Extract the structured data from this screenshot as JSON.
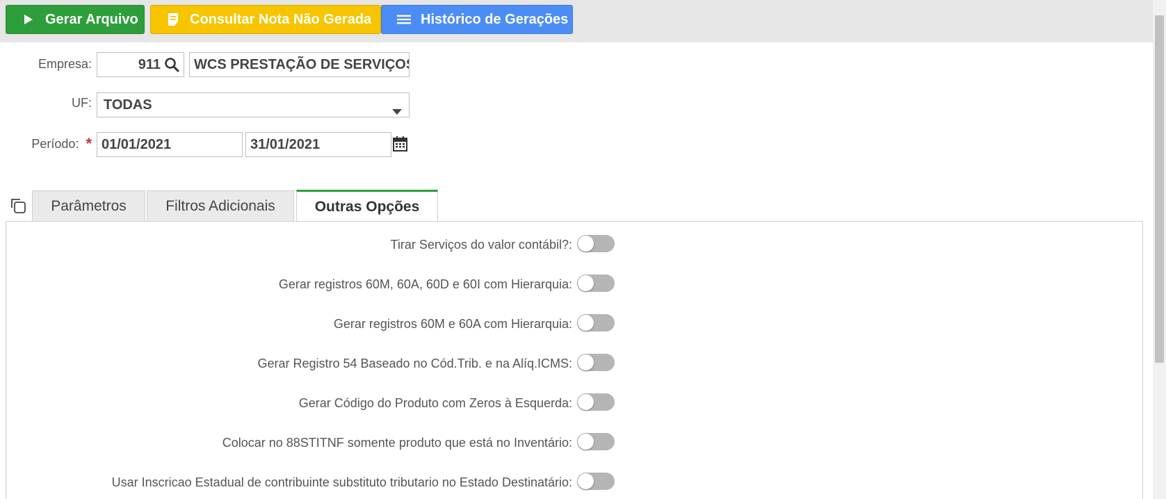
{
  "toolbar": {
    "gerar_label": "Gerar Arquivo",
    "consultar_label": "Consultar Nota Não Gerada",
    "historico_label": "Histórico de Gerações"
  },
  "form": {
    "empresa_label": "Empresa:",
    "empresa_code": "911",
    "empresa_name": "WCS PRESTAÇÃO DE SERVIÇOS",
    "uf_label": "UF:",
    "uf_value": "TODAS",
    "periodo_label": "Período:",
    "periodo_required": "*",
    "periodo_start": "01/01/2021",
    "periodo_end": "31/01/2021"
  },
  "tabs": [
    {
      "label": "Parâmetros"
    },
    {
      "label": "Filtros Adicionais"
    },
    {
      "label": "Outras Opções"
    }
  ],
  "options": [
    {
      "label": "Tirar Serviços do valor contábil?:",
      "enabled": false
    },
    {
      "label": "Gerar registros 60M, 60A, 60D e 60I com Hierarquia:",
      "enabled": false
    },
    {
      "label": "Gerar registros 60M e 60A com Hierarquia:",
      "enabled": false
    },
    {
      "label": "Gerar Registro 54 Baseado no Cód.Trib. e na Alíq.ICMS:",
      "enabled": false
    },
    {
      "label": "Gerar Código do Produto com Zeros à Esquerda:",
      "enabled": false
    },
    {
      "label": "Colocar no 88STITNF somente produto que está no Inventário:",
      "enabled": false
    },
    {
      "label": "Usar Inscricao Estadual de contribuinte substituto tributario no Estado Destinatário:",
      "enabled": false
    }
  ],
  "colors": {
    "gerar": "#2e9e3b",
    "consultar": "#f7c500",
    "historico": "#4c8df5",
    "active_tab_accent": "#2e9e3b"
  },
  "icons": {
    "gerar": "play-icon",
    "consultar": "note-icon",
    "historico": "list-icon",
    "empresa_search": "search-icon",
    "uf_dropdown": "caret-down-icon",
    "periodo": "calendar-icon",
    "tabs": "copy-icon"
  }
}
